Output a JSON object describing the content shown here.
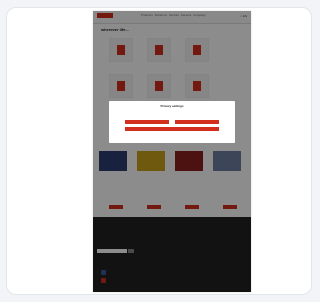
{
  "site": {
    "header": {
      "nav": [
        "Products",
        "Solutions",
        "Service",
        "Careers",
        "Company"
      ],
      "language": "EN"
    },
    "page_title": "wherever life...",
    "categories": [
      "",
      "",
      "",
      "",
      "",
      ""
    ],
    "products_heading": "",
    "products": [
      {
        "name": "",
        "desc": ""
      },
      {
        "name": "",
        "desc": ""
      },
      {
        "name": "",
        "desc": ""
      },
      {
        "name": "",
        "desc": ""
      }
    ],
    "footer": {
      "cols": [
        "",
        "",
        "",
        ""
      ]
    }
  },
  "consent_modal": {
    "title": "Privacy settings",
    "text": "",
    "accept_label": "",
    "reject_label": "",
    "settings_label": "",
    "links": ""
  },
  "colors": {
    "brand": "#d32f1e",
    "footer": "#222222",
    "overlay": "rgba(0,0,0,0.45)"
  }
}
